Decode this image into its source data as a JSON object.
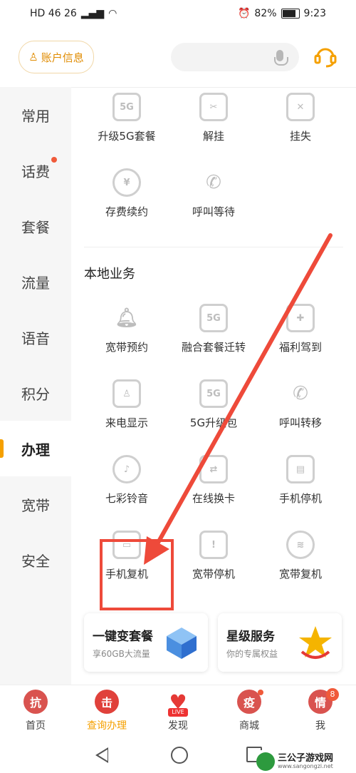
{
  "status_bar": {
    "left": "HD 46 26",
    "battery": "82%",
    "time": "9:23"
  },
  "header": {
    "account_label": "账户信息"
  },
  "sidebar": {
    "items": [
      {
        "label": "常用",
        "dot": false
      },
      {
        "label": "话费",
        "dot": true
      },
      {
        "label": "套餐",
        "dot": false
      },
      {
        "label": "流量",
        "dot": false
      },
      {
        "label": "语音",
        "dot": false
      },
      {
        "label": "积分",
        "dot": false
      },
      {
        "label": "办理",
        "dot": false,
        "active": true
      },
      {
        "label": "宽带",
        "dot": false
      },
      {
        "label": "安全",
        "dot": false
      }
    ]
  },
  "top_services": [
    {
      "label": "升级5G套餐",
      "icon": "5g-home-icon"
    },
    {
      "label": "解挂",
      "icon": "unlock-icon"
    },
    {
      "label": "挂失",
      "icon": "phone-lost-icon"
    },
    {
      "label": "存费续约",
      "icon": "deposit-icon"
    },
    {
      "label": "呼叫等待",
      "icon": "call-wait-icon"
    }
  ],
  "local_section": {
    "title": "本地业务",
    "items": [
      {
        "label": "宽带预约",
        "icon": "bell-icon"
      },
      {
        "label": "融合套餐迁转",
        "icon": "5g-home-icon"
      },
      {
        "label": "福利驾到",
        "icon": "gift-icon"
      },
      {
        "label": "来电显示",
        "icon": "caller-id-icon"
      },
      {
        "label": "5G升级包",
        "icon": "5g-package-icon"
      },
      {
        "label": "呼叫转移",
        "icon": "call-forward-icon"
      },
      {
        "label": "七彩铃音",
        "icon": "ringtone-icon"
      },
      {
        "label": "在线换卡",
        "icon": "sim-swap-icon"
      },
      {
        "label": "手机停机",
        "icon": "phone-suspend-icon"
      },
      {
        "label": "手机复机",
        "icon": "phone-resume-icon"
      },
      {
        "label": "宽带停机",
        "icon": "broadband-suspend-icon"
      },
      {
        "label": "宽带复机",
        "icon": "broadband-resume-icon"
      }
    ]
  },
  "promo_cards": [
    {
      "title": "一键变套餐",
      "subtitle": "享60GB大流量"
    },
    {
      "title": "星级服务",
      "subtitle": "你的专属权益"
    }
  ],
  "tabbar": [
    {
      "label": "首页",
      "glyph": "抗",
      "color": "#d9534f"
    },
    {
      "label": "查询办理",
      "glyph": "击",
      "color": "#e0413b",
      "active": true
    },
    {
      "label": "发现",
      "glyph": "",
      "color": "#e53935",
      "live": "LIVE"
    },
    {
      "label": "商城",
      "glyph": "疫",
      "color": "#d9534f",
      "dot": true
    },
    {
      "label": "我",
      "glyph": "情",
      "color": "#d9534f",
      "badge": "8"
    }
  ],
  "watermark": {
    "title": "三公子游戏网",
    "url": "www.sangongzi.net"
  }
}
